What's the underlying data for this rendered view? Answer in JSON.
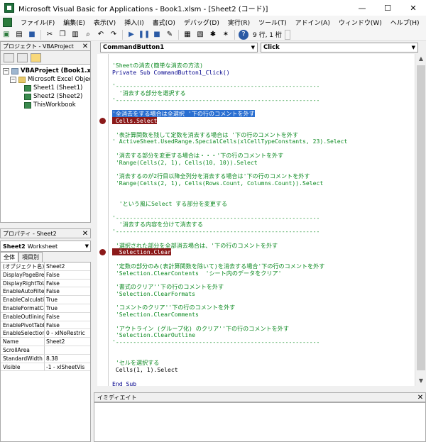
{
  "window": {
    "title": "Microsoft Visual Basic for Applications - Book1.xlsm - [Sheet2 (コード)]",
    "minimize": "—",
    "maximize": "☐",
    "close": "✕"
  },
  "menu": [
    "ファイル(F)",
    "編集(E)",
    "表示(V)",
    "挿入(I)",
    "書式(O)",
    "デバッグ(D)",
    "実行(R)",
    "ツール(T)",
    "アドイン(A)",
    "ウィンドウ(W)",
    "ヘルプ(H)"
  ],
  "toolbar": {
    "position": "9 行, 1 桁"
  },
  "project": {
    "title": "プロジェクト - VBAProject",
    "tree": [
      {
        "label": "VBAProject (Book1.xls",
        "bold": true
      },
      {
        "label": "Microsoft Excel Object"
      },
      {
        "label": "Sheet1 (Sheet1)"
      },
      {
        "label": "Sheet2 (Sheet2)"
      },
      {
        "label": "ThisWorkbook"
      }
    ]
  },
  "properties": {
    "title": "プロパティ - Sheet2",
    "object": "Sheet2",
    "object_type": "Worksheet",
    "tabs": [
      "全体",
      "項目別"
    ],
    "rows": [
      {
        "k": "(オブジェクト名)",
        "v": "Sheet2"
      },
      {
        "k": "DisplayPageBrea",
        "v": "False"
      },
      {
        "k": "DisplayRightToLe",
        "v": "False"
      },
      {
        "k": "EnableAutoFilter",
        "v": "False"
      },
      {
        "k": "EnableCalculatio",
        "v": "True"
      },
      {
        "k": "EnableFormatCo",
        "v": "True"
      },
      {
        "k": "EnableOutlining",
        "v": "False"
      },
      {
        "k": "EnablePivotTable",
        "v": "False"
      },
      {
        "k": "EnableSelection",
        "v": "0 - xlNoRestric"
      },
      {
        "k": "Name",
        "v": "Sheet2"
      },
      {
        "k": "ScrollArea",
        "v": ""
      },
      {
        "k": "StandardWidth",
        "v": "8.38"
      },
      {
        "k": "Visible",
        "v": "-1 - xlSheetVis"
      }
    ]
  },
  "code": {
    "object_combo": "CommandButton1",
    "proc_combo": "Click",
    "lines": [
      {
        "t": "'Sheetの消去(簡単な消去の方法)",
        "c": "comment"
      },
      {
        "t": "Private Sub CommandButton1_Click()",
        "c": "kw"
      },
      {
        "t": "",
        "c": "code"
      },
      {
        "t": "'-----------------------------------------------------------",
        "c": "comment"
      },
      {
        "t": "  '消去する部分を選択する",
        "c": "comment"
      },
      {
        "t": "'-----------------------------------------------------------",
        "c": "comment"
      },
      {
        "t": "",
        "c": "code"
      },
      {
        "t": "'全消去をする場合は全選択 '下の行のコメントを外す",
        "c": "sel"
      },
      {
        "t": " Cells.Select",
        "c": "bp"
      },
      {
        "t": "",
        "c": "code"
      },
      {
        "t": " '表計算関数を残して定数を消去する場合は '下の行のコメントを外す",
        "c": "comment"
      },
      {
        "t": "' ActiveSheet.UsedRange.SpecialCells(xlCellTypeConstants, 23).Select",
        "c": "comment"
      },
      {
        "t": "",
        "c": "code"
      },
      {
        "t": " '消去する部分を変更する場合は・・・'下の行のコメントを外す",
        "c": "comment"
      },
      {
        "t": " 'Range(Cells(2, 1), Cells(10, 10)).Select",
        "c": "comment"
      },
      {
        "t": "",
        "c": "code"
      },
      {
        "t": " '消去するのが2行目以降全列分を消去する場合は'下の行のコメントを外す",
        "c": "comment"
      },
      {
        "t": " 'Range(Cells(2, 1), Cells(Rows.Count, Columns.Count)).Select",
        "c": "comment"
      },
      {
        "t": "",
        "c": "code"
      },
      {
        "t": "",
        "c": "code"
      },
      {
        "t": "  'という風にSelect する部分を変更する",
        "c": "comment"
      },
      {
        "t": "",
        "c": "code"
      },
      {
        "t": "'-----------------------------------------------------------",
        "c": "comment"
      },
      {
        "t": "  '消去する内容を分けて消去する",
        "c": "comment"
      },
      {
        "t": "'-----------------------------------------------------------",
        "c": "comment"
      },
      {
        "t": "",
        "c": "code"
      },
      {
        "t": " '選択された部分を全部消去場合は、'下の行のコメントを外す",
        "c": "comment"
      },
      {
        "t": "  Selection.Clear",
        "c": "bp"
      },
      {
        "t": "",
        "c": "code"
      },
      {
        "t": " '定数の部分のみ(表計算関数を除いて)を消去する場合'下の行のコメントを外す",
        "c": "comment"
      },
      {
        "t": " 'Selection.ClearContents  'シート内のデータをクリア'",
        "c": "comment"
      },
      {
        "t": "",
        "c": "code"
      },
      {
        "t": " '書式のクリア''下の行のコメントを外す",
        "c": "comment"
      },
      {
        "t": " 'Selection.ClearFormats",
        "c": "comment"
      },
      {
        "t": "",
        "c": "code"
      },
      {
        "t": " 'コメントのクリア''下の行のコメントを外す",
        "c": "comment"
      },
      {
        "t": " 'Selection.ClearComments",
        "c": "comment"
      },
      {
        "t": "",
        "c": "code"
      },
      {
        "t": " 'アウトライン (グループ化) のクリア''下の行のコメントを外す",
        "c": "comment"
      },
      {
        "t": " 'Selection.ClearOutline",
        "c": "comment"
      },
      {
        "t": "'-----------------------------------------------------------",
        "c": "comment"
      },
      {
        "t": "",
        "c": "code"
      },
      {
        "t": "",
        "c": "code"
      },
      {
        "t": " 'セルを選択する",
        "c": "comment"
      },
      {
        "t": " Cells(1, 1).Select",
        "c": "code"
      },
      {
        "t": "",
        "c": "code"
      },
      {
        "t": "End Sub",
        "c": "kw"
      }
    ]
  },
  "immediate": {
    "title": "イミディエイト"
  }
}
